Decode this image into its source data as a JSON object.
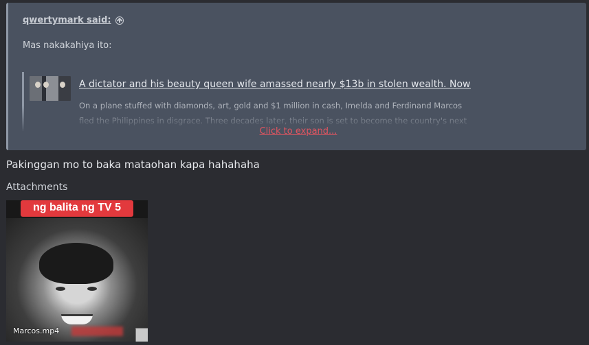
{
  "quote": {
    "author": "qwertymark said:",
    "author_icon": "arrow-up-circle-icon",
    "text": "Mas nakakahiya ito:",
    "embed": {
      "title": "A dictator and his beauty queen wife amassed nearly $13b in stolen wealth. Now ...",
      "description": "On a plane stuffed with diamonds, art, gold and $1 million in cash, Imelda and Ferdinand Marcos fled the Philippines in disgrace. Three decades later, their son is set to become the country's next president."
    },
    "expand_label": "Click to expand..."
  },
  "reply_text": "Pakinggan mo to baka mataohan kapa hahahaha",
  "attachments": {
    "label": "Attachments",
    "items": [
      {
        "banner_text": "ng balita ng TV 5",
        "filename": "Marcos.mp4"
      }
    ]
  },
  "colors": {
    "background": "#2b2c31",
    "quote_background": "#4a5260",
    "expand_link": "#e05560",
    "banner": "#e2393d"
  }
}
